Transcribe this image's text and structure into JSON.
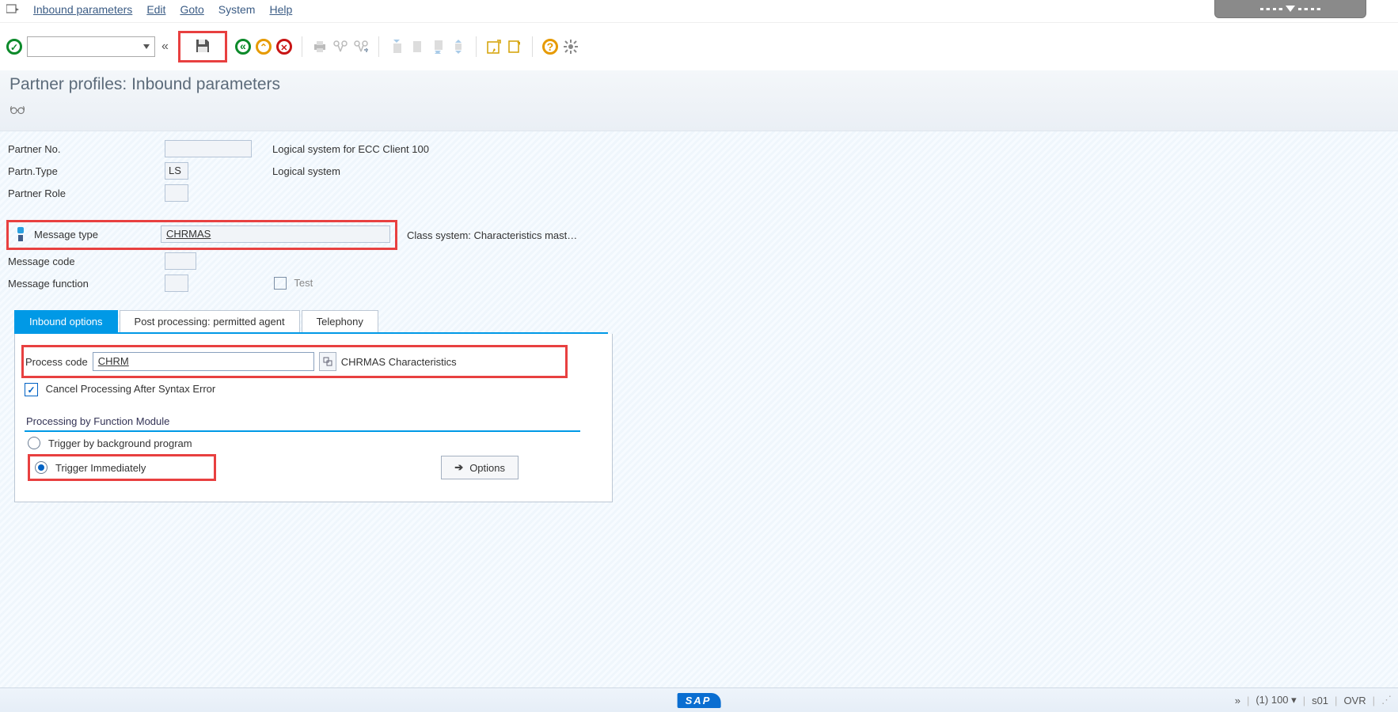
{
  "menu": {
    "items": [
      "Inbound parameters",
      "Edit",
      "Goto",
      "System",
      "Help"
    ]
  },
  "title": "Partner profiles: Inbound parameters",
  "fields": {
    "partner_no_label": "Partner No.",
    "partner_no_value": "",
    "partner_no_desc": "Logical system for ECC Client 100",
    "partn_type_label": "Partn.Type",
    "partn_type_value": "LS",
    "partn_type_desc": "Logical system",
    "partner_role_label": "Partner Role",
    "partner_role_value": "",
    "message_type_label": "Message type",
    "message_type_value": "CHRMAS",
    "message_type_desc": "Class system: Characteristics mast…",
    "message_code_label": "Message code",
    "message_code_value": "",
    "message_function_label": "Message function",
    "message_function_value": "",
    "test_label": "Test"
  },
  "tabs": {
    "tab1": "Inbound options",
    "tab2": "Post processing: permitted agent",
    "tab3": "Telephony"
  },
  "inbound": {
    "process_code_label": "Process code",
    "process_code_value": "CHRM",
    "process_code_desc": "CHRMAS Characteristics",
    "cancel_label": "Cancel Processing After Syntax Error",
    "group_title": "Processing by Function Module",
    "radio_bg": "Trigger by background program",
    "radio_immediate": "Trigger Immediately",
    "options_btn": "Options"
  },
  "status": {
    "expand": "»",
    "session": "(1) 100",
    "sys": " s01",
    "mode": "OVR"
  },
  "logo": "SAP"
}
